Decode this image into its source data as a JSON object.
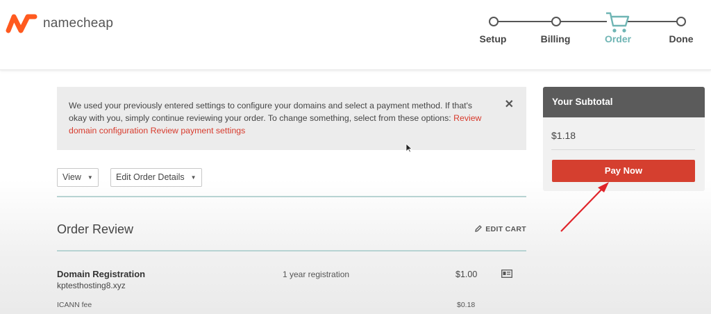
{
  "brand": {
    "name": "namecheap",
    "accent": "#ff5a1f"
  },
  "steps": [
    {
      "label": "Setup",
      "active": false
    },
    {
      "label": "Billing",
      "active": false
    },
    {
      "label": "Order",
      "active": true
    },
    {
      "label": "Done",
      "active": false
    }
  ],
  "notice": {
    "text": "We used your previously entered settings to configure your domains and select a payment method. If that's okay with you, simply continue reviewing your order. To change something, select from these options: ",
    "link_domain": "Review domain configuration",
    "link_payment": "Review payment settings",
    "close_label": "✕"
  },
  "toolbar": {
    "view_label": "View",
    "edit_order_label": "Edit Order Details"
  },
  "order_review": {
    "title": "Order Review",
    "edit_cart_label": "EDIT CART",
    "items": [
      {
        "name": "Domain Registration",
        "domain": "kptesthosting8.xyz",
        "term": "1 year registration",
        "price": "$1.00"
      }
    ],
    "fees": [
      {
        "name": "ICANN fee",
        "price": "$0.18"
      }
    ]
  },
  "subtotal": {
    "header": "Your Subtotal",
    "amount": "$1.18",
    "pay_label": "Pay Now"
  },
  "colors": {
    "step_active": "#6fb5b4",
    "pay_button": "#d53f2f",
    "link": "#d73a2c",
    "annotation_arrow": "#e0242a"
  }
}
